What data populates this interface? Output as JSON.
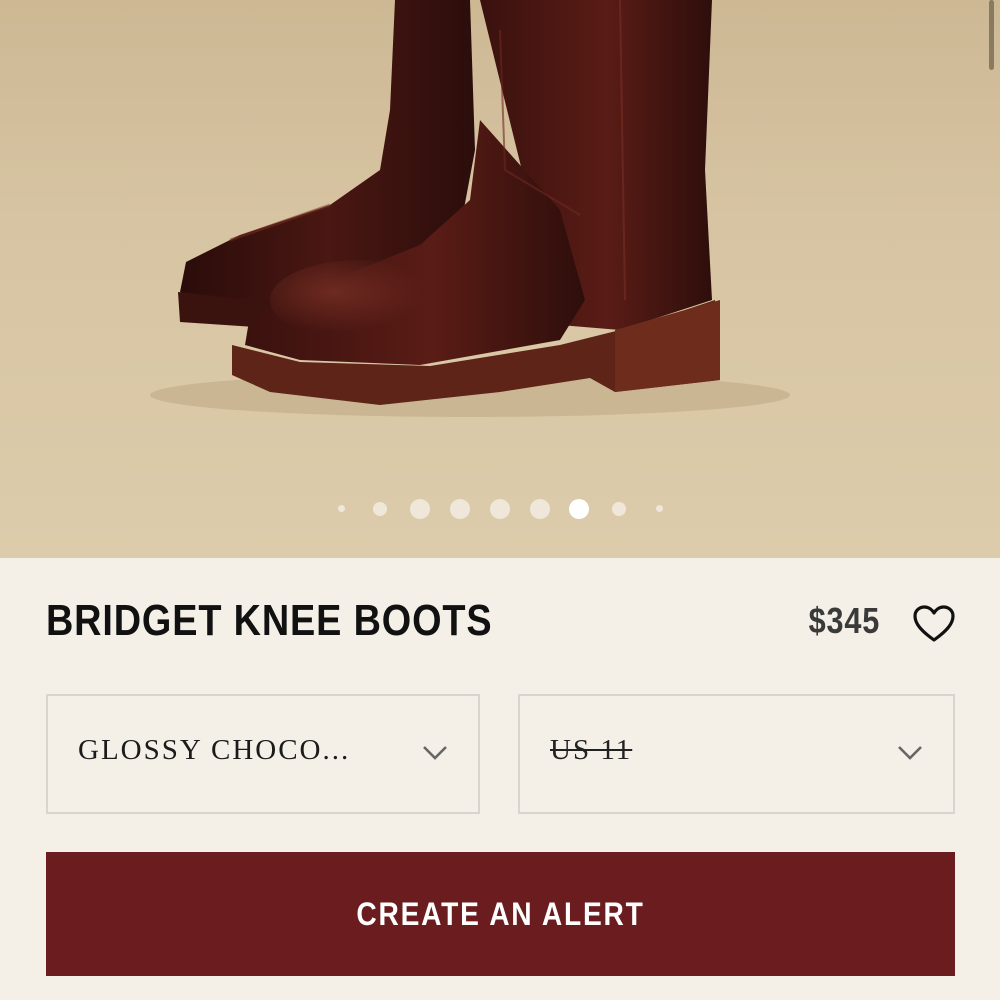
{
  "product": {
    "image_alt": "Dark brown leather knee boots",
    "gallery": {
      "count": 9,
      "active_index": 5
    },
    "title": "BRIDGET KNEE BOOTS",
    "price": "$345",
    "wishlist_icon": "heart-outline-icon"
  },
  "options": {
    "color": {
      "value": "GLOSSY CHOCO...",
      "icon": "chevron-down-icon"
    },
    "size": {
      "value": "US 11",
      "unavailable": true,
      "icon": "chevron-down-icon"
    }
  },
  "cta": {
    "label": "CREATE AN ALERT",
    "color": "#6b1c1e"
  },
  "colors": {
    "background": "#f4f0e8",
    "accent": "#6b1c1e"
  }
}
